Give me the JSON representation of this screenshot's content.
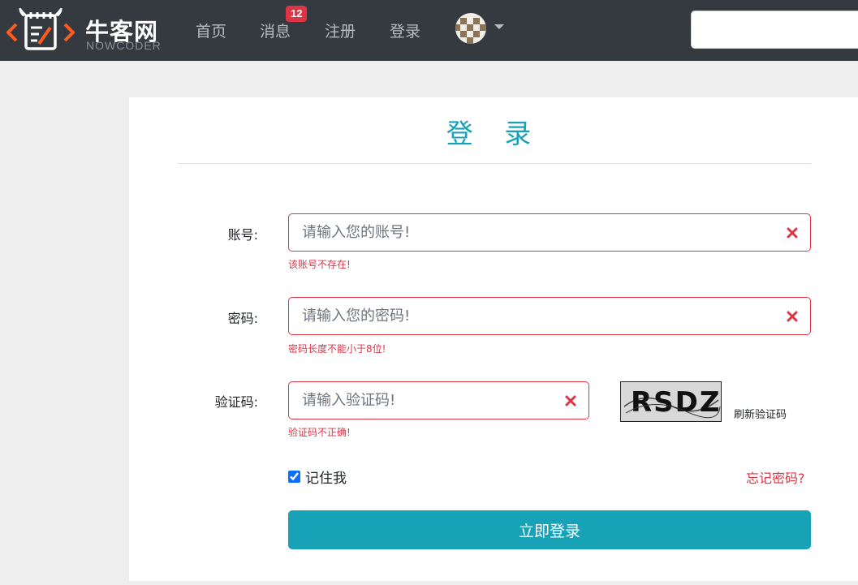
{
  "brand": {
    "name_cn": "牛客网",
    "name_en": "NOWCODER",
    "color": "#ff5a1f"
  },
  "nav": {
    "items": [
      {
        "label": "首页"
      },
      {
        "label": "消息",
        "badge": "12"
      },
      {
        "label": "注册"
      },
      {
        "label": "登录"
      }
    ],
    "search_placeholder": ""
  },
  "form": {
    "title": "登 录",
    "account": {
      "label": "账号:",
      "placeholder": "请输入您的账号!",
      "value": "",
      "error": "该账号不存在!"
    },
    "password": {
      "label": "密码:",
      "placeholder": "请输入您的密码!",
      "value": "",
      "error": "密码长度不能小于8位!"
    },
    "captcha": {
      "label": "验证码:",
      "placeholder": "请输入验证码!",
      "value": "",
      "error": "验证码不正确!",
      "image_text": "RSDZ",
      "refresh_label": "刷新验证码"
    },
    "remember_label": "记住我",
    "remember_checked": true,
    "forgot_label": "忘记密码?",
    "submit_label": "立即登录"
  },
  "colors": {
    "navbar": "#343a40",
    "accent": "#17a2b8",
    "danger": "#dc3545"
  }
}
